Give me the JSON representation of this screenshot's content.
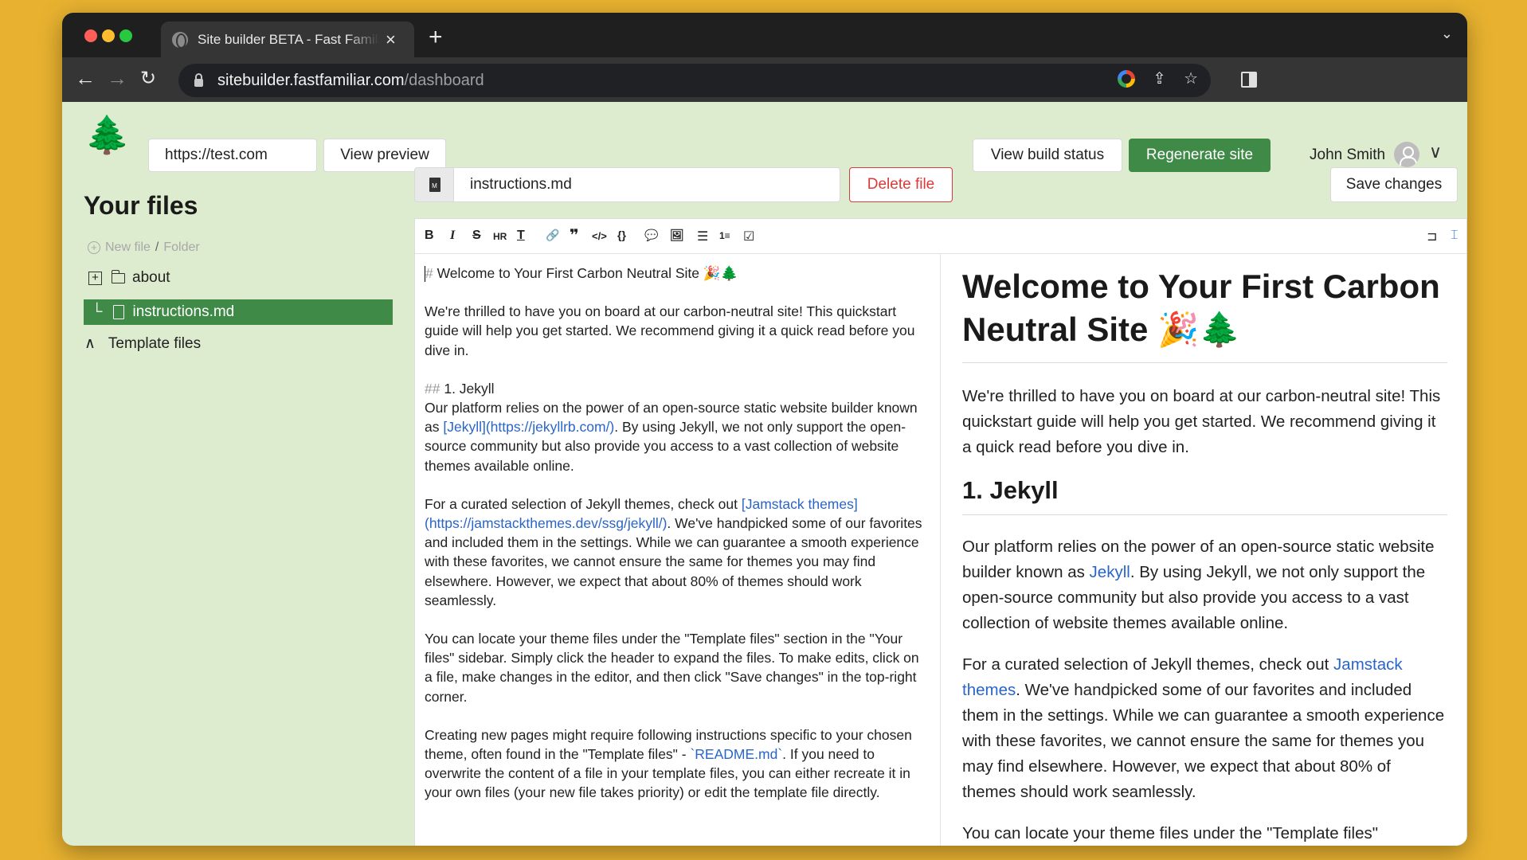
{
  "browser": {
    "tab_title": "Site builder BETA - Fast Familiar",
    "url_host": "sitebuilder.fastfamiliar.com",
    "url_path": "/dashboard",
    "traffic_colors": [
      "#FF5F57",
      "#FEBC2E",
      "#28C840"
    ]
  },
  "header": {
    "logo": "🌲",
    "site_url": "https://test.com",
    "view_preview": "View preview",
    "view_build_status": "View build status",
    "regenerate_site": "Regenerate site",
    "user_name": "John Smith"
  },
  "sidebar": {
    "title": "Your files",
    "new_file": "New file",
    "slash": "/",
    "new_folder": "Folder",
    "tree": [
      {
        "type": "folder",
        "label": "about"
      },
      {
        "type": "file",
        "label": "instructions.md",
        "selected": true
      }
    ],
    "template_files": "Template files"
  },
  "file_bar": {
    "filename": "instructions.md",
    "delete_file": "Delete file",
    "save_changes": "Save changes"
  },
  "editor": {
    "toolbar": [
      "B",
      "I",
      "S",
      "HR",
      "T",
      "🔗",
      "❞",
      "</>",
      "{}",
      "💬",
      "🖼",
      "☰",
      "1≡",
      "☑"
    ],
    "line_heading": "Welcome to Your First Carbon Neutral Site 🎉🌲",
    "p1": "We're thrilled to have you on board at our carbon-neutral site! This quickstart guide will help you get started. We recommend giving it a quick read before you dive in.",
    "h2_mark": "##",
    "h2_text": "1. Jekyll",
    "p2_a": "Our platform relies on the power of an open-source static website builder known as",
    "p2_link": "[Jekyll](https://jekyllrb.com/)",
    "p2_b": ". By using Jekyll, we not only support the open-source community but also provide you access to a vast collection of website themes available online.",
    "p3_a": "For a curated selection of Jekyll themes, check out",
    "p3_link": "[Jamstack themes](https://jamstackthemes.dev/ssg/jekyll/)",
    "p3_b": ". We've handpicked some of our favorites and included them in the settings. While we can guarantee a smooth experience with these favorites, we cannot ensure the same for themes you may find elsewhere. However, we expect that about 80% of themes should work seamlessly.",
    "p4": "You can locate your theme files under the \"Template files\" section in the \"Your files\" sidebar. Simply click the header to expand the files. To make edits, click on a file, make changes in the editor, and then click \"Save changes\" in the top-right corner.",
    "p5_a": "Creating new pages might require following instructions specific to your chosen theme, often found in the \"Template files\" -",
    "p5_code": "`README.md`",
    "p5_b": ". If you need to overwrite the content of a file in your template files, you can either recreate it in your own files (your new file takes priority) or edit the template file directly."
  },
  "preview": {
    "h1": "Welcome to Your First Carbon Neutral Site 🎉🌲",
    "p1": "We're thrilled to have you on board at our carbon-neutral site! This quickstart guide will help you get started. We recommend giving it a quick read before you dive in.",
    "h2": "1. Jekyll",
    "p2_a": "Our platform relies on the power of an open-source static website builder known as",
    "p2_link": "Jekyll",
    "p2_b": ". By using Jekyll, we not only support the open-source community but also provide you access to a vast collection of website themes available online.",
    "p3_a": "For a curated selection of Jekyll themes, check out",
    "p3_link": "Jamstack themes",
    "p3_b": ". We've handpicked some of our favorites and included them in the settings. While we can guarantee a smooth experience with these favorites, we cannot ensure the same for themes you may find elsewhere. However, we expect that about 80% of themes should work seamlessly.",
    "p4_partial": "You can locate your theme files under the \"Template files\""
  },
  "colors": {
    "accent_green": "#3F8A47",
    "danger_red": "#D93A3A",
    "link_blue": "#2A65C8",
    "page_bg": "#DDEBCF"
  }
}
